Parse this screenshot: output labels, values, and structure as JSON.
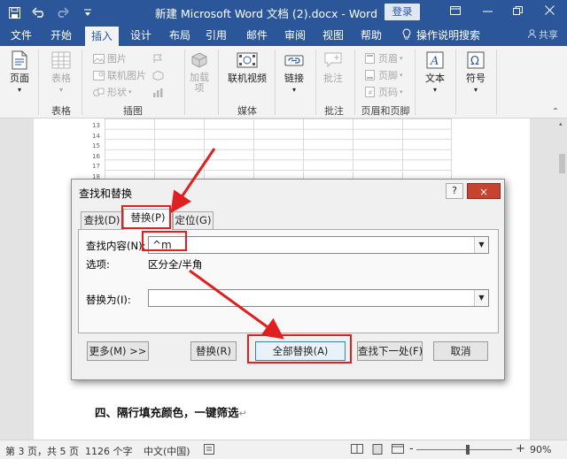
{
  "window": {
    "title": "新建 Microsoft Word 文档 (2).docx  -  Word",
    "login_label": "登录",
    "quick_access": [
      "save-icon",
      "undo-icon",
      "redo-icon",
      "customize-icon"
    ],
    "controls": [
      "minimize-icon",
      "restore-icon",
      "close-icon"
    ]
  },
  "tabs": [
    {
      "label": "文件"
    },
    {
      "label": "开始"
    },
    {
      "label": "插入",
      "active": true
    },
    {
      "label": "设计"
    },
    {
      "label": "布局"
    },
    {
      "label": "引用"
    },
    {
      "label": "邮件"
    },
    {
      "label": "审阅"
    },
    {
      "label": "视图"
    },
    {
      "label": "帮助"
    }
  ],
  "tell_me": "操作说明搜索",
  "share_label": "共享",
  "ribbon": {
    "groups": [
      {
        "label": "页面"
      },
      {
        "label": "表格"
      },
      {
        "label": "插图"
      },
      {
        "label": ""
      },
      {
        "label": "媒体"
      },
      {
        "label": ""
      },
      {
        "label": "批注"
      },
      {
        "label": "页眉和页脚"
      },
      {
        "label": ""
      },
      {
        "label": ""
      }
    ],
    "buttons": {
      "pages": "页面",
      "table": "表格",
      "pictures": "图片",
      "online_pictures": "联机图片",
      "shapes": "形状",
      "addins": "加载项",
      "online_video": "联机视频",
      "link": "链接",
      "comment": "批注",
      "header": "页眉",
      "footer": "页脚",
      "page_number": "页码",
      "text": "文本",
      "symbol": "符号"
    }
  },
  "document": {
    "row_numbers": [
      "13",
      "14",
      "15",
      "16",
      "17",
      "18"
    ],
    "heading": "四、隔行填充颜色，一键筛选",
    "paragraph_mark": "↵"
  },
  "dialog": {
    "title": "查找和替换",
    "help": "?",
    "close": "×",
    "tabs": [
      {
        "label": "查找(D)"
      },
      {
        "label": "替换(P)",
        "active": true
      },
      {
        "label": "定位(G)"
      }
    ],
    "find_label": "查找内容(N):",
    "find_value": "^m",
    "options_label": "选项:",
    "options_value": "区分全/半角",
    "replace_label": "替换为(I):",
    "replace_value": "",
    "buttons": {
      "more": "更多(M) >>",
      "replace": "替换(R)",
      "replace_all": "全部替换(A)",
      "find_next": "查找下一处(F)",
      "cancel": "取消"
    }
  },
  "status": {
    "page": "第 3 页，共 5 页",
    "words": "1126 个字",
    "language": "中文(中国)",
    "zoom": "90%",
    "zoom_out": "-",
    "zoom_in": "+"
  },
  "colors": {
    "word_blue": "#2b579a",
    "annotation_red": "#e02020"
  }
}
